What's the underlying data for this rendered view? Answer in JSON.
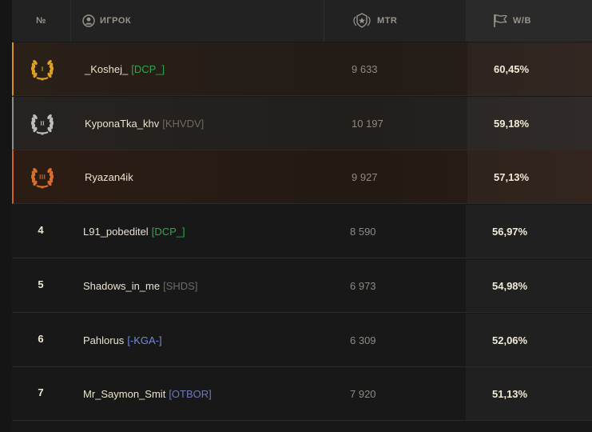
{
  "header": {
    "rank_label": "№",
    "player_label": "ИГРОК",
    "mtr_label": "MTR",
    "wb_label": "W/B"
  },
  "rows": [
    {
      "rank": "I",
      "medal": "gold",
      "name": "_Koshej_",
      "clan": "[DCP_]",
      "clan_color": "#2fa84a",
      "mtr": "9 633",
      "wb": "60,45%"
    },
    {
      "rank": "II",
      "medal": "silver",
      "name": "KyponaTka_khv",
      "clan": "[KHVDV]",
      "clan_color": "#6f6a64",
      "mtr": "10 197",
      "wb": "59,18%"
    },
    {
      "rank": "III",
      "medal": "bronze",
      "name": "Ryazan4ik",
      "clan": "",
      "clan_color": "#6f6a64",
      "mtr": "9 927",
      "wb": "57,13%"
    },
    {
      "rank": "4",
      "medal": "",
      "name": "L91_pobeditel",
      "clan": "[DCP_]",
      "clan_color": "#2fa84a",
      "mtr": "8 590",
      "wb": "56,97%"
    },
    {
      "rank": "5",
      "medal": "",
      "name": "Shadows_in_me",
      "clan": "[SHDS]",
      "clan_color": "#6f6a64",
      "mtr": "6 973",
      "wb": "54,98%"
    },
    {
      "rank": "6",
      "medal": "",
      "name": "Pahlorus",
      "clan": "[-KGA-]",
      "clan_color": "#6f8ae0",
      "mtr": "6 309",
      "wb": "52,06%"
    },
    {
      "rank": "7",
      "medal": "",
      "name": "Mr_Saymon_Smit",
      "clan": "[OTBOR]",
      "clan_color": "#6f79b8",
      "mtr": "7 920",
      "wb": "51,13%"
    }
  ],
  "colors": {
    "gold": "#e0a020",
    "silver": "#bdbdbd",
    "bronze": "#d86f2a"
  }
}
